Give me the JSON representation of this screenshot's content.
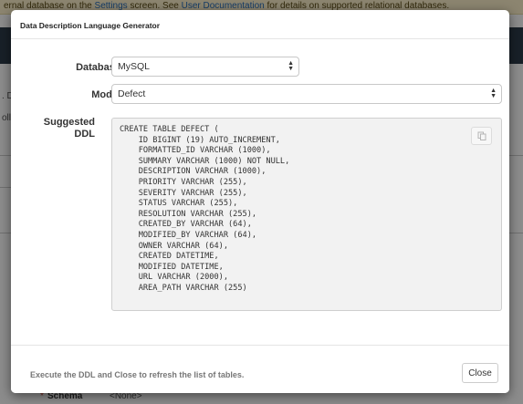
{
  "background": {
    "banner": {
      "prefix": "ernal database on the ",
      "link1": "Settings",
      "middle": " screen. See ",
      "link2": "User Documentation",
      "suffix": " for details on supported relational databases."
    },
    "left_letters": [
      ". D",
      "oll"
    ],
    "bottom_row": {
      "required_mark": "*",
      "label": "Schema",
      "value": "<None>"
    }
  },
  "modal": {
    "title": "Data Description Language Generator",
    "database": {
      "label": "Database",
      "value": "MySQL"
    },
    "model": {
      "label": "Model",
      "value": "Defect"
    },
    "ddl": {
      "label_line1": "Suggested",
      "label_line2": "DDL",
      "text": "CREATE TABLE DEFECT (\n    ID BIGINT (19) AUTO_INCREMENT,\n    FORMATTED_ID VARCHAR (1000),\n    SUMMARY VARCHAR (1000) NOT NULL,\n    DESCRIPTION VARCHAR (1000),\n    PRIORITY VARCHAR (255),\n    SEVERITY VARCHAR (255),\n    STATUS VARCHAR (255),\n    RESOLUTION VARCHAR (255),\n    CREATED_BY VARCHAR (64),\n    MODIFIED_BY VARCHAR (64),\n    OWNER VARCHAR (64),\n    CREATED DATETIME,\n    MODIFIED DATETIME,\n    URL VARCHAR (2000),\n    AREA_PATH VARCHAR (255)"
    },
    "footer": {
      "message": "Execute the DDL and Close to refresh the list of tables.",
      "close_label": "Close"
    }
  }
}
